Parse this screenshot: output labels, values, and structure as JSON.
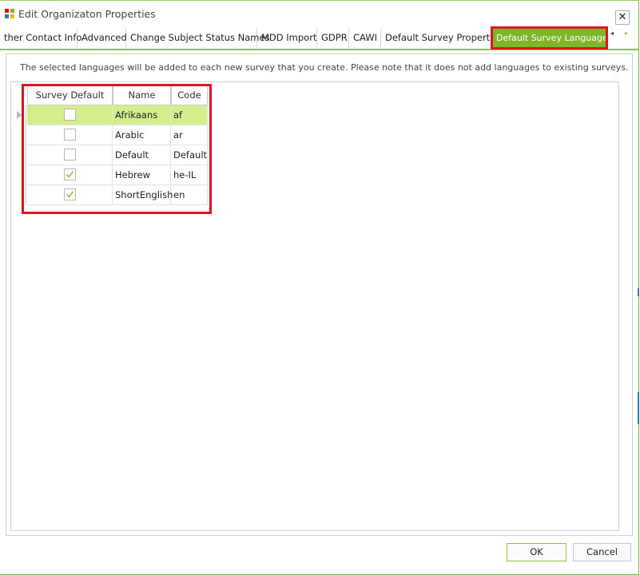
{
  "window": {
    "title": "Edit Organizaton Properties",
    "close_label": "✕"
  },
  "tabs": [
    {
      "label": "ther Contact Info",
      "active": false
    },
    {
      "label": "Advanced",
      "active": false
    },
    {
      "label": "Change Subject Status Names",
      "active": false
    },
    {
      "label": "MDD Import",
      "active": false
    },
    {
      "label": "GDPR",
      "active": false
    },
    {
      "label": "CAWI",
      "active": false
    },
    {
      "label": "Default Survey Properties",
      "active": false
    },
    {
      "label": "Default Survey Languages",
      "active": true
    }
  ],
  "tab_scroll": {
    "left": "◂",
    "right": "▸"
  },
  "info_text": "The selected languages will be added to each new survey that you create. Please note that it does not add languages to existing surveys.",
  "grid": {
    "columns": [
      "Survey Default",
      "Name",
      "Code"
    ],
    "rows": [
      {
        "survey_default": false,
        "name": "Afrikaans",
        "code": "af",
        "selected": true
      },
      {
        "survey_default": false,
        "name": "Arabic",
        "code": "ar",
        "selected": false
      },
      {
        "survey_default": false,
        "name": "Default",
        "code": "Default",
        "selected": false
      },
      {
        "survey_default": true,
        "name": "Hebrew",
        "code": "he-IL",
        "selected": false
      },
      {
        "survey_default": true,
        "name": "ShortEnglish",
        "code": "en",
        "selected": false
      }
    ]
  },
  "buttons": {
    "ok": "OK",
    "cancel": "Cancel"
  },
  "colors": {
    "accent": "#7ab828",
    "highlight": "#e0141e",
    "selected_row": "#d4ee8c"
  }
}
